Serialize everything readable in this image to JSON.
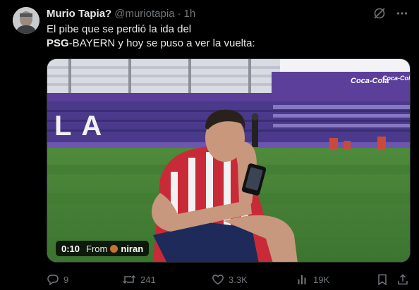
{
  "author": {
    "name": "Murio Tapia?",
    "handle": "@muriotapia",
    "separator": "·",
    "time": "1h"
  },
  "post": {
    "line1": "El pibe que se perdió la ida del",
    "line2_bold": "PSG",
    "line2_rest": "-BAYERN y hoy se puso a ver la vuelta:"
  },
  "video": {
    "duration": "0:10",
    "from_label": "From",
    "source": "niran",
    "stadium_letters": "LA",
    "sponsor_1": "Coca-Cola",
    "sponsor_2": "Coca-Cola"
  },
  "actions": {
    "replies": "9",
    "reposts": "241",
    "likes": "3.3K",
    "views": "19K"
  },
  "colors": {
    "background": "#000000",
    "text_primary": "#e7e9ea",
    "text_secondary": "#71767b"
  },
  "icons": [
    "grok-icon",
    "more-icon",
    "reply-icon",
    "repost-icon",
    "like-icon",
    "views-icon",
    "bookmark-icon",
    "share-icon"
  ]
}
